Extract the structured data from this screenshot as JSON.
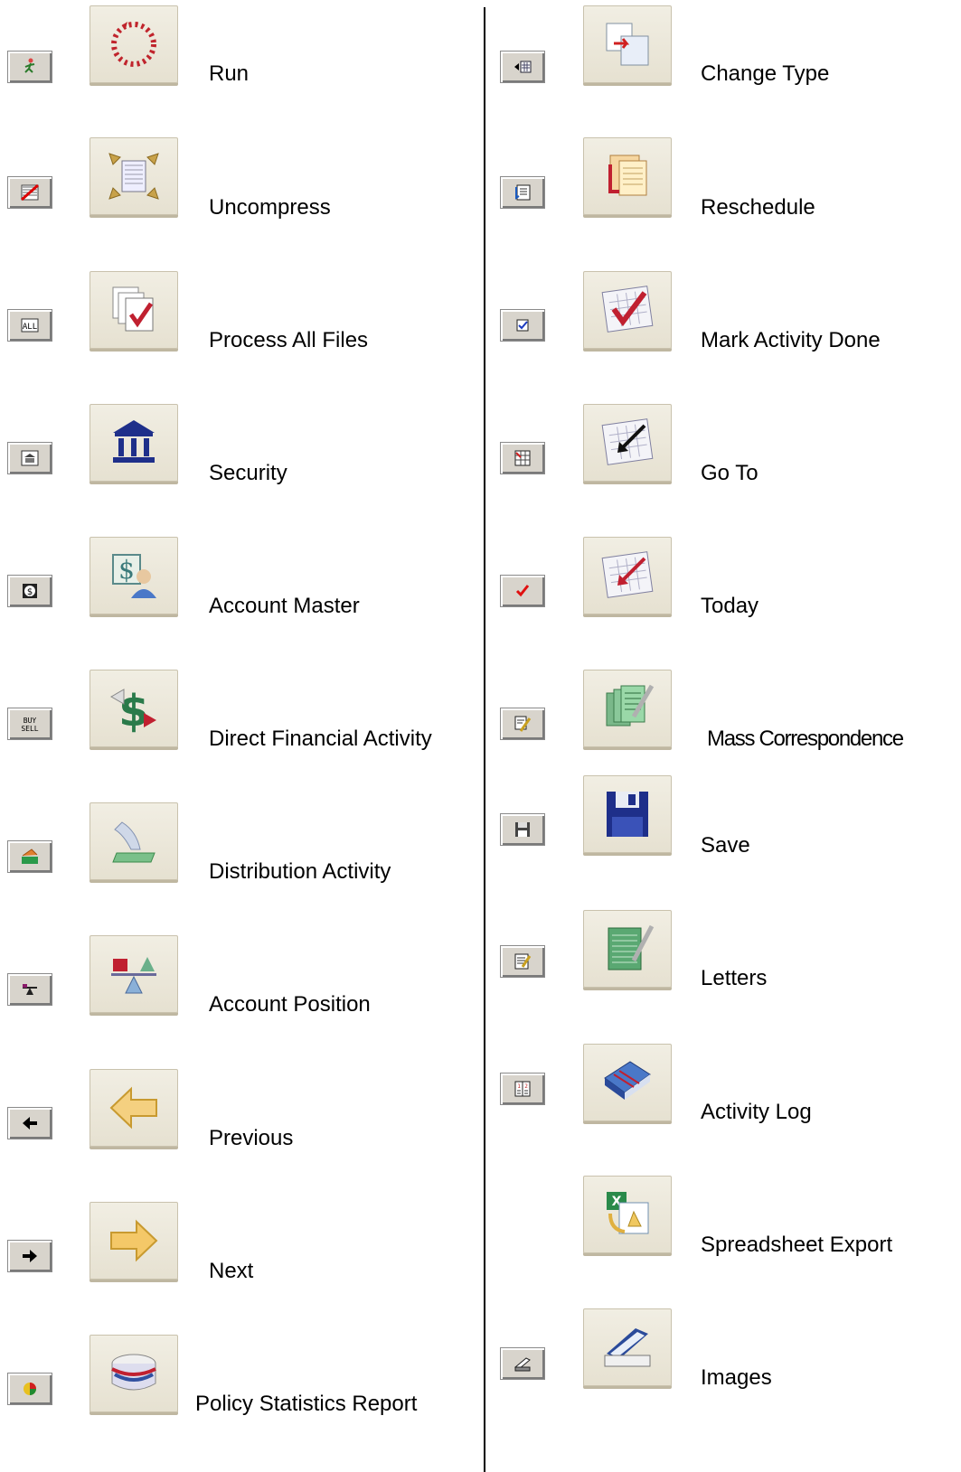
{
  "left_column": [
    {
      "label": "Run",
      "small_icon": "run-small-icon",
      "large_icon": "run-icon"
    },
    {
      "label": "Uncompress",
      "small_icon": "uncompress-small-icon",
      "large_icon": "uncompress-icon"
    },
    {
      "label": "Process All Files",
      "small_icon": "all-small-icon",
      "large_icon": "process-all-files-icon"
    },
    {
      "label": "Security",
      "small_icon": "security-small-icon",
      "large_icon": "bank-icon"
    },
    {
      "label": "Account Master",
      "small_icon": "account-master-small-icon",
      "large_icon": "dollar-person-icon"
    },
    {
      "label": "Direct Financial Activity",
      "small_icon": "buy-sell-icon",
      "large_icon": "dollar-exchange-icon"
    },
    {
      "label": "Distribution Activity",
      "small_icon": "distribution-small-icon",
      "large_icon": "hand-money-icon"
    },
    {
      "label": "Account Position",
      "small_icon": "balance-small-icon",
      "large_icon": "balance-scale-icon"
    },
    {
      "label": "Previous",
      "small_icon": "arrow-left-small-icon",
      "large_icon": "arrow-left-icon"
    },
    {
      "label": "Next",
      "small_icon": "arrow-right-small-icon",
      "large_icon": "arrow-right-icon"
    },
    {
      "label": "Policy Statistics Report",
      "small_icon": "pie-small-icon",
      "large_icon": "report-icon"
    }
  ],
  "right_column": [
    {
      "label": "Change Type",
      "small_icon": "change-type-small-icon",
      "large_icon": "change-type-icon"
    },
    {
      "label": "Reschedule",
      "small_icon": "reschedule-small-icon",
      "large_icon": "reschedule-icon"
    },
    {
      "label": "Mark Activity Done",
      "small_icon": "checkbox-small-icon",
      "large_icon": "calendar-check-icon"
    },
    {
      "label": "Go To",
      "small_icon": "goto-small-icon",
      "large_icon": "calendar-arrow-icon"
    },
    {
      "label": "Today",
      "small_icon": "checkmark-small-icon",
      "large_icon": "calendar-today-icon"
    },
    {
      "label": "Mass Correspondence",
      "small_icon": "pencil-note-small-icon",
      "large_icon": "documents-pencil-icon"
    },
    {
      "label": "Save",
      "small_icon": "floppy-small-icon",
      "large_icon": "floppy-disk-icon"
    },
    {
      "label": "Letters",
      "small_icon": "edit-note-small-icon",
      "large_icon": "letter-pencil-icon"
    },
    {
      "label": "Activity Log",
      "small_icon": "log-small-icon",
      "large_icon": "book-icon"
    },
    {
      "label": "Spreadsheet Export",
      "small_icon": "",
      "large_icon": "spreadsheet-export-icon"
    },
    {
      "label": "Images",
      "small_icon": "scanner-small-icon",
      "large_icon": "scanner-icon"
    }
  ],
  "colors": {
    "button_face": "#e6e1d1",
    "divider": "#000000"
  }
}
